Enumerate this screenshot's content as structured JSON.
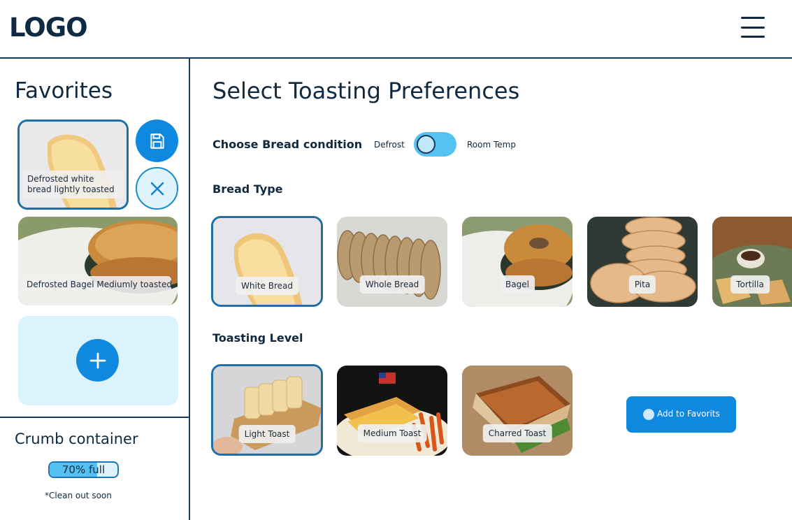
{
  "header": {
    "logo": "LOGO",
    "menu_icon": "hamburger-menu-icon"
  },
  "sidebar": {
    "favorites_title": "Favorites",
    "favorites": [
      {
        "label": "Defrosted white bread lightly toasted",
        "selected": true
      },
      {
        "label": "Defrosted Bagel Mediumly toasted",
        "selected": false
      }
    ],
    "save_icon": "save-icon",
    "remove_icon": "close-icon",
    "add_icon": "plus-icon",
    "crumb": {
      "title": "Crumb container",
      "badge": "70% full",
      "fill_fraction": 0.7,
      "note": "*Clean out soon"
    }
  },
  "main": {
    "title": "Select Toasting Preferences",
    "condition": {
      "label": "Choose Bread condition",
      "option_a": "Defrost",
      "option_b": "Room Temp",
      "selected": "Defrost"
    },
    "bread_type": {
      "label": "Bread Type",
      "items": [
        {
          "label": "White Bread",
          "selected": true
        },
        {
          "label": "Whole Bread",
          "selected": false
        },
        {
          "label": "Bagel",
          "selected": false
        },
        {
          "label": "Pita",
          "selected": false
        },
        {
          "label": "Tortilla",
          "selected": false
        }
      ]
    },
    "toasting_level": {
      "label": "Toasting Level",
      "items": [
        {
          "label": "Light Toast",
          "selected": true
        },
        {
          "label": "Medium Toast",
          "selected": false
        },
        {
          "label": "Charred Toast",
          "selected": false
        }
      ]
    },
    "cta": "Add to Favorits"
  },
  "colors": {
    "accent": "#0f88e0",
    "dark": "#10293f",
    "light_blue": "#dbf3fd",
    "toggle": "#55c2f4"
  }
}
